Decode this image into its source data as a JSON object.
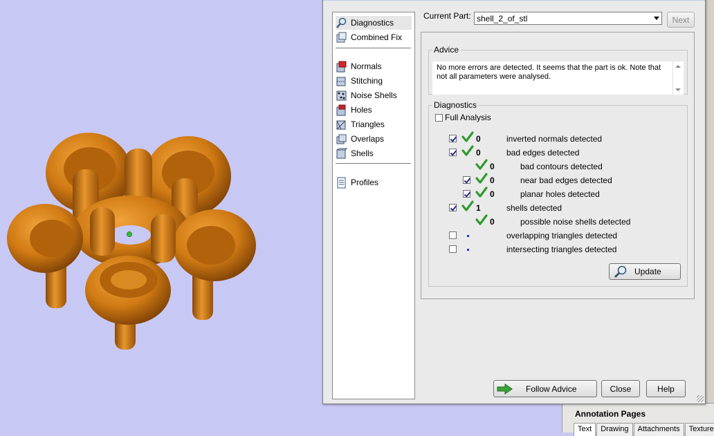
{
  "dialog": {
    "nav": {
      "items": [
        {
          "label": "Diagnostics",
          "icon": "magnifier-icon",
          "selected": true
        },
        {
          "label": "Combined Fix",
          "icon": "combined-fix-icon"
        },
        {
          "label": "Normals",
          "icon": "normals-icon"
        },
        {
          "label": "Stitching",
          "icon": "stitching-icon"
        },
        {
          "label": "Noise Shells",
          "icon": "noise-shells-icon"
        },
        {
          "label": "Holes",
          "icon": "holes-icon"
        },
        {
          "label": "Triangles",
          "icon": "triangles-icon"
        },
        {
          "label": "Overlaps",
          "icon": "overlaps-icon"
        },
        {
          "label": "Shells",
          "icon": "shells-icon"
        },
        {
          "label": "Profiles",
          "icon": "profiles-icon"
        }
      ]
    },
    "current_part_label": "Current Part:",
    "current_part_value": "shell_2_of_stl",
    "next_label": "Next",
    "advice": {
      "legend": "Advice",
      "text": "No more errors are detected. It seems that the part is ok. Note that not all parameters were analysed."
    },
    "diagnostics": {
      "legend": "Diagnostics",
      "full_analysis_label": "Full Analysis",
      "full_analysis_checked": false,
      "rows": [
        {
          "label": "inverted normals detected",
          "count": "0",
          "checked": true,
          "status": "ok"
        },
        {
          "label": "bad edges detected",
          "count": "0",
          "checked": true,
          "status": "ok"
        },
        {
          "label": "bad contours detected",
          "count": "0",
          "status": "ok"
        },
        {
          "label": "near bad edges detected",
          "count": "0",
          "checked": true,
          "status": "ok"
        },
        {
          "label": "planar holes detected",
          "count": "0",
          "checked": true,
          "status": "ok"
        },
        {
          "label": "shells detected",
          "count": "1",
          "checked": true,
          "status": "ok"
        },
        {
          "label": "possible noise shells detected",
          "count": "0",
          "status": "ok"
        },
        {
          "label": "overlapping triangles detected",
          "checked": false,
          "status": "not-analysed"
        },
        {
          "label": "intersecting triangles detected",
          "checked": false,
          "status": "not-analysed"
        }
      ],
      "update_label": "Update"
    },
    "follow_advice_label": "Follow Advice",
    "close_label": "Close",
    "help_label": "Help"
  },
  "annotation_pages": {
    "title": "Annotation Pages",
    "tabs": [
      "Text",
      "Drawing",
      "Attachments",
      "Texture"
    ],
    "active_tab": "Text"
  },
  "colors": {
    "viewport_bg": "#c8c8f5",
    "model_orange": "#d07a14",
    "check_green": "#2e9a2e"
  }
}
